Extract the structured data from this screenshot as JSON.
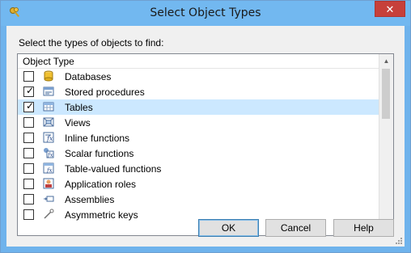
{
  "window": {
    "title": "Select Object Types"
  },
  "dialog": {
    "prompt": "Select the types of objects to find:",
    "list": {
      "header": "Object Type",
      "rows": [
        {
          "label": "Databases",
          "checked": false,
          "icon": "database-icon"
        },
        {
          "label": "Stored procedures",
          "checked": true,
          "icon": "stored-procedure-icon"
        },
        {
          "label": "Tables",
          "checked": true,
          "icon": "table-icon",
          "selected": true
        },
        {
          "label": "Views",
          "checked": false,
          "icon": "view-icon"
        },
        {
          "label": "Inline functions",
          "checked": false,
          "icon": "inline-function-icon"
        },
        {
          "label": "Scalar functions",
          "checked": false,
          "icon": "scalar-function-icon"
        },
        {
          "label": "Table-valued functions",
          "checked": false,
          "icon": "table-valued-function-icon"
        },
        {
          "label": "Application roles",
          "checked": false,
          "icon": "application-role-icon"
        },
        {
          "label": "Assemblies",
          "checked": false,
          "icon": "assembly-icon"
        },
        {
          "label": "Asymmetric keys",
          "checked": false,
          "icon": "asymmetric-key-icon"
        }
      ]
    },
    "buttons": {
      "ok": "OK",
      "cancel": "Cancel",
      "help": "Help"
    }
  },
  "colors": {
    "titlebar": "#72b8f0",
    "selection": "#cce8ff",
    "close": "#c7403a"
  }
}
